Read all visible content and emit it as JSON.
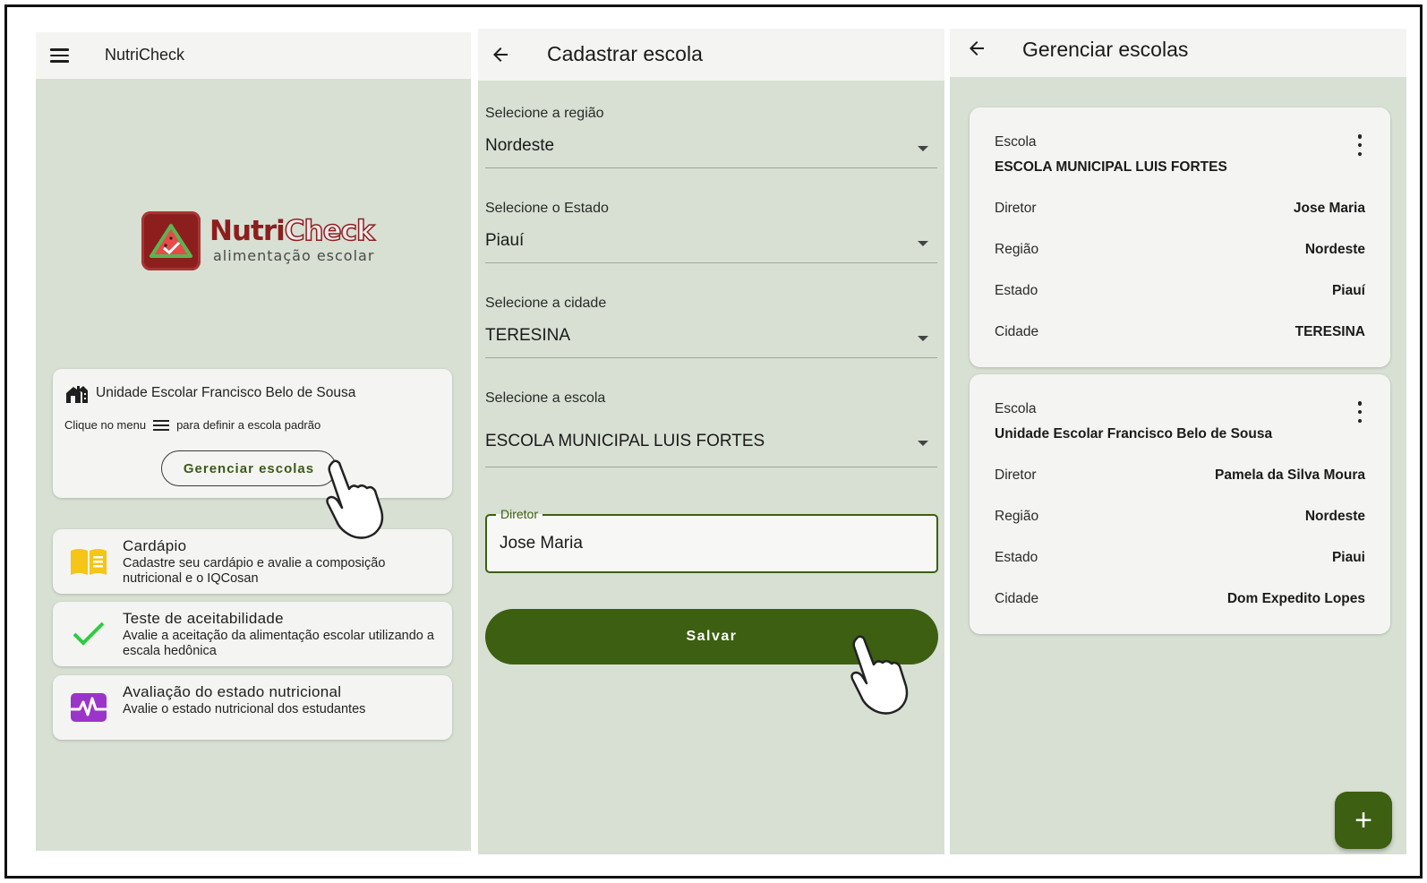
{
  "screen1": {
    "app_title": "NutriCheck",
    "logo": {
      "brand_part1": "Nutri",
      "brand_part2": "Check",
      "tagline": "alimentação escolar"
    },
    "school_card": {
      "school_name": "Unidade Escolar Francisco Belo de Sousa",
      "hint_before": "Clique no menu",
      "hint_after": "para definir a escola padrão",
      "button_label": "Gerenciar escolas"
    },
    "features": [
      {
        "icon": "book-icon",
        "title": "Cardápio",
        "description": "Cadastre seu cardápio e avalie a composição nutricional e o IQCosan"
      },
      {
        "icon": "checkmark-icon",
        "title": "Teste de aceitabilidade",
        "description": "Avalie a aceitação da alimentação escolar utilizando a escala hedônica"
      },
      {
        "icon": "pulse-chart-icon",
        "title": "Avaliação do estado nutricional",
        "description": "Avalie o estado nutricional dos estudantes"
      }
    ]
  },
  "screen2": {
    "title": "Cadastrar escola",
    "fields": [
      {
        "label": "Selecione a região",
        "value": "Nordeste"
      },
      {
        "label": "Selecione o Estado",
        "value": "Piauí"
      },
      {
        "label": "Selecione a cidade",
        "value": "TERESINA"
      },
      {
        "label": "Selecione a escola",
        "value": "ESCOLA MUNICIPAL LUIS FORTES"
      }
    ],
    "director": {
      "label": "Diretor",
      "value": "Jose Maria"
    },
    "save_label": "Salvar"
  },
  "screen3": {
    "title": "Gerenciar escolas",
    "labels": {
      "school": "Escola",
      "director": "Diretor",
      "region": "Região",
      "state": "Estado",
      "city": "Cidade"
    },
    "schools": [
      {
        "name": "ESCOLA MUNICIPAL LUIS FORTES",
        "director": "Jose Maria",
        "region": "Nordeste",
        "state": "Piauí",
        "city": "TERESINA"
      },
      {
        "name": "Unidade Escolar Francisco Belo de Sousa",
        "director": "Pamela da Silva Moura",
        "region": "Nordeste",
        "state": "Piaui",
        "city": "Dom Expedito Lopes"
      }
    ],
    "fab_label": "+"
  },
  "colors": {
    "primary": "#3c5f11",
    "panel_bg": "#d7e0d3",
    "card_bg": "#f4f5f2",
    "logo_red": "#8d1e1e",
    "book_yellow": "#f5c518",
    "check_green": "#2ecc40",
    "pulse_purple": "#9b35c9"
  }
}
